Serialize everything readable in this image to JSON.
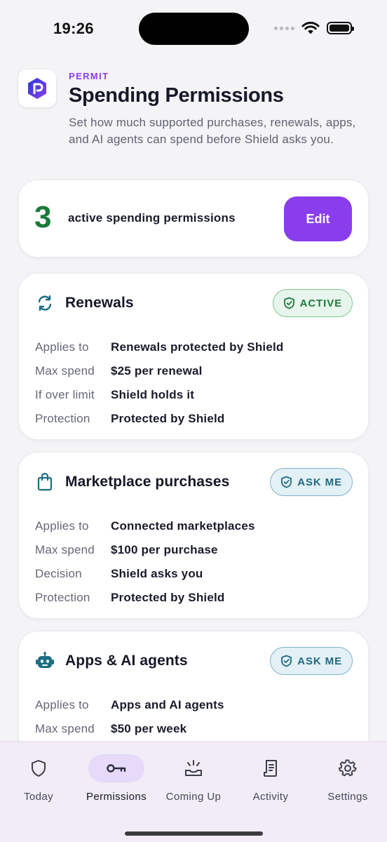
{
  "status": {
    "time": "19:26"
  },
  "header": {
    "eyebrow": "PERMIT",
    "title": "Spending Permissions",
    "subtitle": "Set how much supported purchases, renewals, apps, and AI agents can spend before Shield asks you."
  },
  "summary": {
    "count": "3",
    "label": "active spending permissions",
    "edit_label": "Edit"
  },
  "permissions": [
    {
      "icon": "refresh-icon",
      "title": "Renewals",
      "badge": "ACTIVE",
      "rows": [
        {
          "key": "Applies to",
          "value": "Renewals protected by Shield"
        },
        {
          "key": "Max spend",
          "value": "$25 per renewal"
        },
        {
          "key": "If over limit",
          "value": "Shield holds it"
        },
        {
          "key": "Protection",
          "value": "Protected by Shield"
        }
      ]
    },
    {
      "icon": "shopping-bag-icon",
      "title": "Marketplace purchases",
      "badge": "ASK ME",
      "rows": [
        {
          "key": "Applies to",
          "value": "Connected marketplaces"
        },
        {
          "key": "Max spend",
          "value": "$100 per purchase"
        },
        {
          "key": "Decision",
          "value": "Shield asks you"
        },
        {
          "key": "Protection",
          "value": "Protected by Shield"
        }
      ]
    },
    {
      "icon": "robot-icon",
      "title": "Apps & AI agents",
      "badge": "ASK ME",
      "rows": [
        {
          "key": "Applies to",
          "value": "Apps and AI agents"
        },
        {
          "key": "Max spend",
          "value": "$50 per week"
        }
      ]
    }
  ],
  "tabs": [
    {
      "label": "Today",
      "icon": "shield-icon"
    },
    {
      "label": "Permissions",
      "icon": "key-icon",
      "active": true
    },
    {
      "label": "Coming Up",
      "icon": "sunrise-icon"
    },
    {
      "label": "Activity",
      "icon": "receipt-icon"
    },
    {
      "label": "Settings",
      "icon": "gear-icon"
    }
  ],
  "colors": {
    "accent": "#8a3ded",
    "active_green": "#1f7a3c",
    "ask_teal": "#1f6a86",
    "icon_teal": "#1d6e82"
  }
}
